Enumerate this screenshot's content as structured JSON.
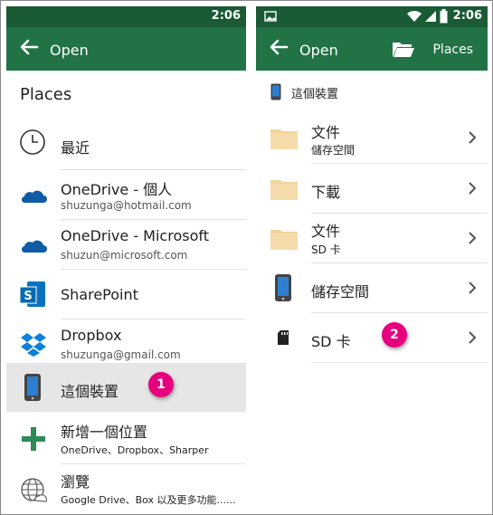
{
  "status": {
    "time": "2:06"
  },
  "left": {
    "toolbar": {
      "title": "Open"
    },
    "heading": "Places",
    "items": [
      {
        "title": "最近"
      },
      {
        "title": "OneDrive - 個人",
        "subtitle": "shuzunga@hotmail.com"
      },
      {
        "title": "OneDrive - Microsoft",
        "subtitle": "shuzun@microsoft.com"
      },
      {
        "title": "SharePoint"
      },
      {
        "title": "Dropbox",
        "subtitle": "shuzunga@gmail.com"
      },
      {
        "title": "這個裝置"
      },
      {
        "title": "新增一個位置",
        "subtitle": "OneDrive、Dropbox、Sharper"
      },
      {
        "title": "瀏覽",
        "subtitle": "Google Drive、Box 以及更多功能......"
      }
    ],
    "badge": "1"
  },
  "right": {
    "toolbar": {
      "title": "Open",
      "places_label": "Places"
    },
    "section": "這個裝置",
    "items": [
      {
        "title": "文件",
        "subtitle": "儲存空間"
      },
      {
        "title": "下載"
      },
      {
        "title": "文件",
        "subtitle": "SD 卡"
      },
      {
        "title": "儲存空間"
      },
      {
        "title": "SD 卡"
      }
    ],
    "badge": "2"
  },
  "colors": {
    "toolbar": "#217346",
    "statusbar": "#1a5a35",
    "badge": "#e6007e",
    "folder": "#f2d39b"
  }
}
